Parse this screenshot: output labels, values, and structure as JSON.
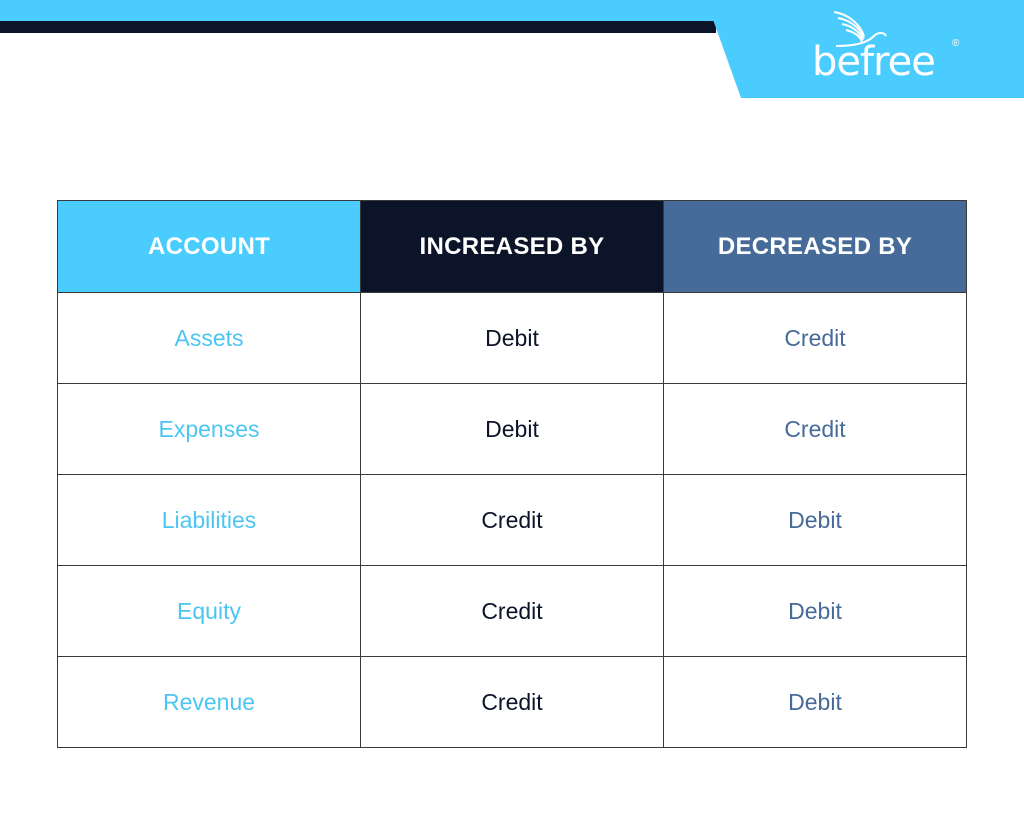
{
  "brand": {
    "name": "befree",
    "registered_mark": "®",
    "colors": {
      "sky": "#4accff",
      "navy": "#0b1428",
      "steel": "#476b99"
    }
  },
  "table": {
    "headers": [
      "ACCOUNT",
      "INCREASED BY",
      "DECREASED BY"
    ],
    "rows": [
      {
        "account": "Assets",
        "increased_by": "Debit",
        "decreased_by": "Credit"
      },
      {
        "account": "Expenses",
        "increased_by": "Debit",
        "decreased_by": "Credit"
      },
      {
        "account": "Liabilities",
        "increased_by": "Credit",
        "decreased_by": "Debit"
      },
      {
        "account": "Equity",
        "increased_by": "Credit",
        "decreased_by": "Debit"
      },
      {
        "account": "Revenue",
        "increased_by": "Credit",
        "decreased_by": "Debit"
      }
    ]
  }
}
